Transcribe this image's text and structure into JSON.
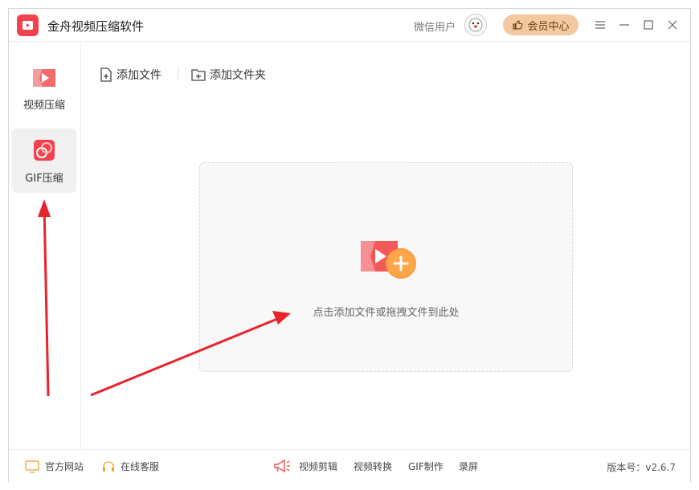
{
  "app": {
    "title": "金舟视频压缩软件"
  },
  "header": {
    "wechat_user": "微信用户",
    "vip_label": "会员中心"
  },
  "sidebar": {
    "items": [
      {
        "label": "视频压缩",
        "icon": "video-play-icon",
        "active": false
      },
      {
        "label": "GIF压缩",
        "icon": "gif-icon",
        "active": true
      }
    ]
  },
  "toolbar": {
    "add_file": "添加文件",
    "add_folder": "添加文件夹"
  },
  "dropzone": {
    "hint": "点击添加文件或拖拽文件到此处"
  },
  "footer": {
    "official_site": "官方网站",
    "online_service": "在线客服",
    "tools": [
      "视频剪辑",
      "视频转换",
      "GIF制作",
      "录屏"
    ],
    "version": "版本号：v2.6.7"
  },
  "colors": {
    "brand": "#f2424f",
    "vip_bg": "#f3c9a1",
    "accent_orange": "#ff9a3c",
    "annotation_arrow": "#e8232a"
  }
}
